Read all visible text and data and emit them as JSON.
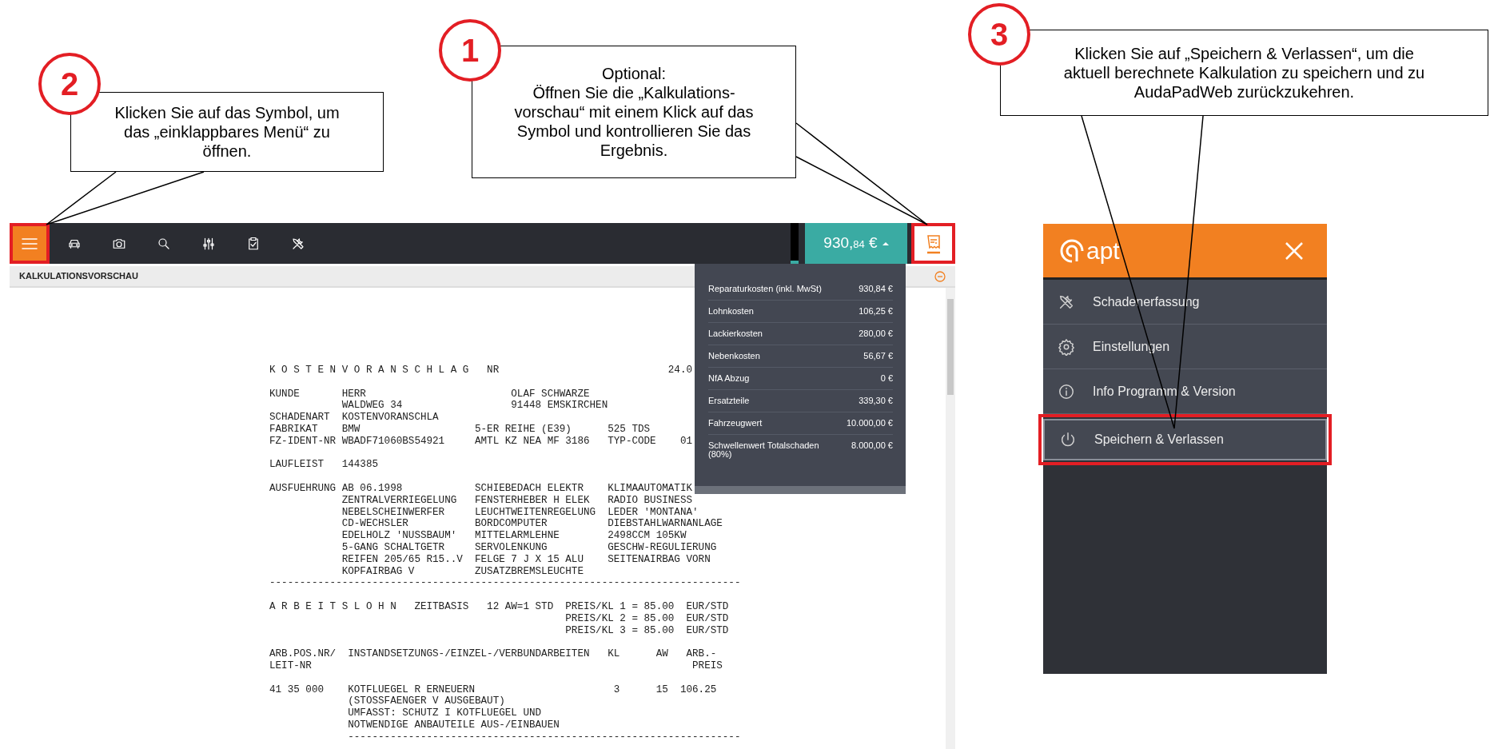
{
  "callouts": [
    {
      "number": "2",
      "text": "Klicken Sie auf das Symbol, um\ndas „einklappbares Menü“ zu\nöffnen."
    },
    {
      "number": "1",
      "text": "Optional:\nÖffnen Sie die „Kalkulations-\nvorschau“ mit einem Klick auf das\nSymbol und kontrollieren Sie das\nErgebnis."
    },
    {
      "number": "3",
      "text": "Klicken Sie auf „Speichern & Verlassen“, um die\naktuell berechnete Kalkulation zu speichern und zu\nAudaPadWeb zurückzukehren."
    }
  ],
  "toolbar": {
    "items": [
      {
        "kind": "menu",
        "highlighted": true
      },
      {
        "kind": "car",
        "highlighted": false
      },
      {
        "kind": "camera",
        "highlighted": false
      },
      {
        "kind": "search",
        "highlighted": false
      },
      {
        "kind": "sliders",
        "highlighted": false
      },
      {
        "kind": "clipboard",
        "highlighted": false
      },
      {
        "kind": "tools",
        "highlighted": false
      }
    ]
  },
  "price": {
    "amount": "930,",
    "fraction": "84",
    "currency": "€"
  },
  "preview_button": {
    "highlighted": true
  },
  "section_title": "KALKULATIONSVORSCHAU",
  "cost_summary": [
    {
      "label": "Reparaturkosten (inkl. MwSt)",
      "value": "930,84 €"
    },
    {
      "label": "Lohnkosten",
      "value": "106,25 €"
    },
    {
      "label": "Lackierkosten",
      "value": "280,00 €"
    },
    {
      "label": "Nebenkosten",
      "value": "56,67 €"
    },
    {
      "label": "NfA Abzug",
      "value": "0 €"
    },
    {
      "label": "Ersatzteile",
      "value": "339,30 €"
    },
    {
      "label": "Fahrzeugwert",
      "value": "10.000,00 €"
    },
    {
      "label": "Schwellenwert Totalschaden (80%)",
      "value": "8.000,00 €"
    }
  ],
  "document": {
    "blocks": [
      [
        "K O S T E N V O R A N S C H L A G   NR                            24.0"
      ],
      [
        "KUNDE       HERR                        OLAF SCHWARZE",
        "            WALDWEG 34                  91448 EMSKIRCHEN",
        "SCHADENART  KOSTENVORANSCHLA",
        "FABRIKAT    BMW                   5-ER REIHE (E39)      525 TDS",
        "FZ-IDENT-NR WBADF71060BS54921     AMTL KZ NEA MF 3186   TYP-CODE    01"
      ],
      [
        "LAUFLEIST   144385"
      ],
      [
        "AUSFUEHRUNG AB 06.1998            SCHIEBEDACH ELEKTR    KLIMAAUTOMATIK",
        "            ZENTRALVERRIEGELUNG   FENSTERHEBER H ELEK   RADIO BUSINESS",
        "            NEBELSCHEINWERFER     LEUCHTWEITENREGELUNG  LEDER 'MONTANA'",
        "            CD-WECHSLER           BORDCOMPUTER          DIEBSTAHLWARNANLAGE",
        "            EDELHOLZ 'NUSSBAUM'   MITTELARMLEHNE        2498CCM 105KW",
        "            5-GANG SCHALTGETR     SERVOLENKUNG          GESCHW-REGULIERUNG",
        "            REIFEN 205/65 R15..V  FELGE 7 J X 15 ALU    SEITENAIRBAG VORN",
        "            KOPFAIRBAG V          ZUSATZBREMSLEUCHTE",
        "------------------------------------------------------------------------------"
      ],
      [
        "A R B E I T S L O H N   ZEITBASIS   12 AW=1 STD  PREIS/KL 1 = 85.00  EUR/STD",
        "                                                 PREIS/KL 2 = 85.00  EUR/STD",
        "                                                 PREIS/KL 3 = 85.00  EUR/STD"
      ],
      [
        "ARB.POS.NR/  INSTANDSETZUNGS-/EINZEL-/VERBUNDARBEITEN   KL      AW   ARB.-",
        "LEIT-NR                                                               PREIS"
      ],
      [
        "41 35 000    KOTFLUEGEL R ERNEUERN                       3      15  106.25",
        "             (STOSSFAENGER V AUSGEBAUT)",
        "             UMFASST: SCHUTZ I KOTFLUEGEL UND",
        "             NOTWENDIGE ANBAUTEILE AUS-/EINBAUEN",
        "             -----------------------------------------------------------------"
      ]
    ]
  },
  "side_menu": {
    "logo": "apt",
    "items": [
      {
        "kind": "tools",
        "label": "Schadenerfassung",
        "highlighted": false
      },
      {
        "kind": "gear",
        "label": "Einstellungen",
        "highlighted": false
      },
      {
        "kind": "info",
        "label": "Info Programm & Version",
        "highlighted": false
      },
      {
        "kind": "power",
        "label": "Speichern & Verlassen",
        "highlighted": true
      }
    ]
  }
}
